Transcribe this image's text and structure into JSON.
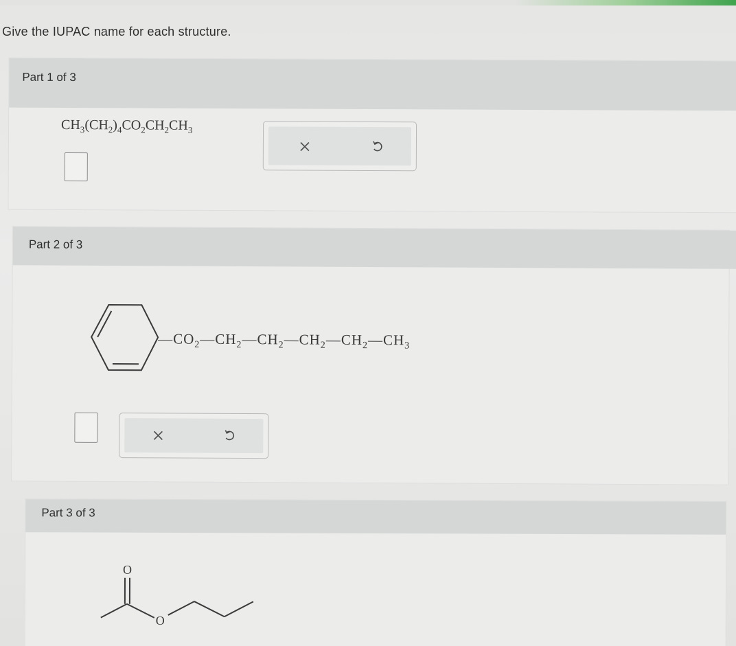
{
  "question": "Give the IUPAC name for each structure.",
  "parts": [
    {
      "label": "Part 1 of 3",
      "formula": {
        "pieces": [
          "CH",
          "3",
          "(CH",
          "2",
          ")",
          "4",
          "CO",
          "2",
          "CH",
          "2",
          "CH",
          "3"
        ]
      },
      "answer_value": "",
      "tools": {
        "clear": "clear-x",
        "undo": "undo-arrow"
      }
    },
    {
      "label": "Part 2 of 3",
      "chain": {
        "pieces": [
          "—CO",
          "2",
          "—CH",
          "2",
          "—CH",
          "2",
          "—CH",
          "2",
          "—CH",
          "2",
          "—CH",
          "3"
        ]
      },
      "answer_value": "",
      "tools": {
        "clear": "clear-x",
        "undo": "undo-arrow"
      }
    },
    {
      "label": "Part 3 of 3",
      "structure_atoms": [
        "O",
        "O"
      ]
    }
  ],
  "colors": {
    "accent_green": "#3fa34d",
    "header_gray": "#d5d7d7"
  }
}
